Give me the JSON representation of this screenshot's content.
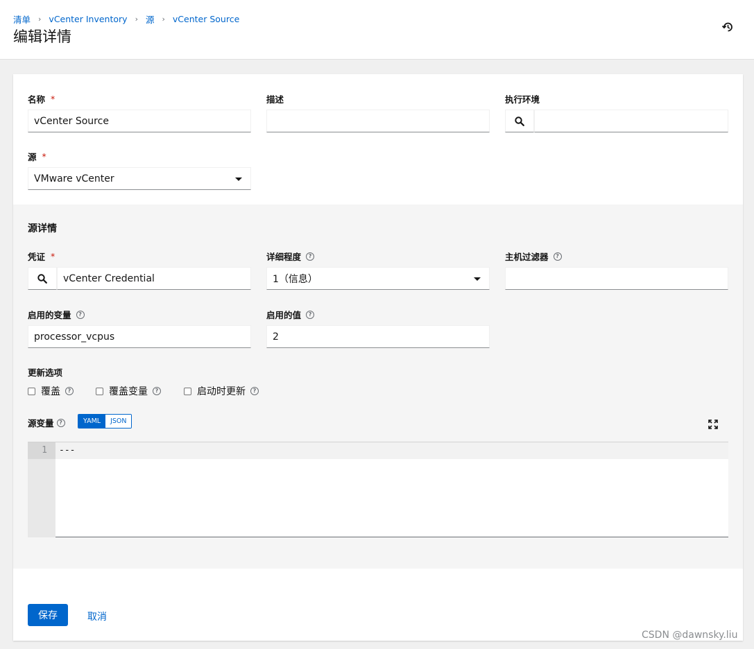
{
  "breadcrumb": {
    "items": [
      "清单",
      "vCenter Inventory",
      "源",
      "vCenter Source"
    ],
    "separator": "›"
  },
  "page_title": "编辑详情",
  "form": {
    "name": {
      "label": "名称",
      "required": "*",
      "value": "vCenter Source"
    },
    "description": {
      "label": "描述",
      "value": ""
    },
    "execution_env": {
      "label": "执行环境",
      "value": ""
    },
    "source": {
      "label": "源",
      "required": "*",
      "value": "VMware vCenter"
    }
  },
  "details": {
    "title": "源详情",
    "credential": {
      "label": "凭证",
      "required": "*",
      "value": "vCenter Credential"
    },
    "verbosity": {
      "label": "详细程度",
      "value": "1（信息）"
    },
    "host_filter": {
      "label": "主机过滤器",
      "value": ""
    },
    "enabled_var": {
      "label": "启用的变量",
      "value": "processor_vcpus"
    },
    "enabled_value": {
      "label": "启用的值",
      "value": "2"
    },
    "update_options": {
      "label": "更新选项",
      "overwrite": "覆盖",
      "overwrite_vars": "覆盖变量",
      "update_on_launch": "启动时更新"
    },
    "source_vars": {
      "label": "源变量",
      "yaml": "YAML",
      "json": "JSON",
      "line_number": "1",
      "code": "---"
    }
  },
  "actions": {
    "save": "保存",
    "cancel": "取消"
  },
  "watermark": "CSDN @dawnsky.liu",
  "colors": {
    "primary": "#0066cc",
    "required": "#c9190b",
    "header_bg": "#ffffff",
    "page_bg": "#f0f0f0"
  },
  "icons": {
    "history": "history-icon",
    "search": "search-icon",
    "help": "help-circle-icon",
    "expand": "expand-icon",
    "caret": "caret-down-icon"
  }
}
